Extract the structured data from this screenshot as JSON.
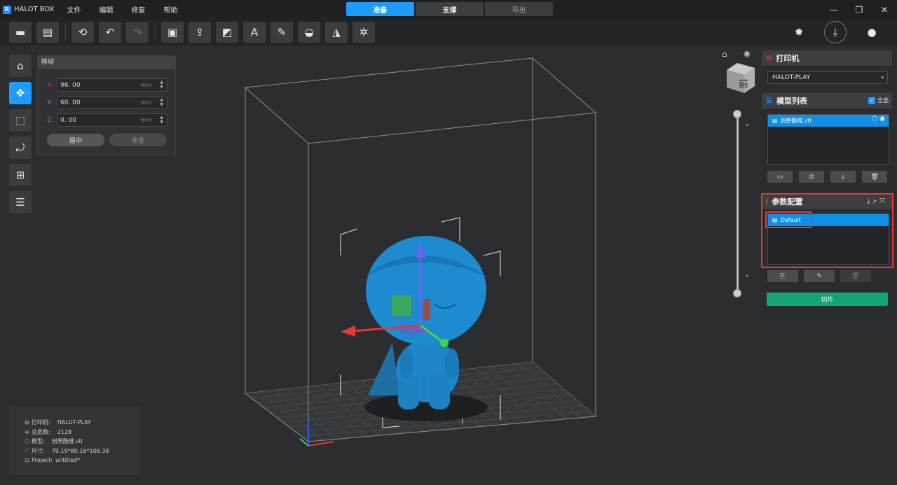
{
  "app": {
    "title": "HALOT BOX",
    "logo": "R"
  },
  "menu": [
    "文件",
    "编辑",
    "修复",
    "帮助"
  ],
  "mode_tabs": [
    {
      "label": "准备",
      "state": "active"
    },
    {
      "label": "支撑",
      "state": "normal"
    },
    {
      "label": "导出",
      "state": "disabled"
    }
  ],
  "window_controls": {
    "minimize": "—",
    "restore": "❐",
    "close": "✕"
  },
  "toolbar": {
    "open": "▬",
    "import": "▤",
    "history": "⟲",
    "undo": "↶",
    "redo": "↷",
    "tools": [
      "▣",
      "⇪",
      "◩",
      "A",
      "✎",
      "◒",
      "◮",
      "✲"
    ],
    "right": {
      "settings": "✹",
      "download": "⤓",
      "user": "●"
    }
  },
  "left_tools": [
    "⌂",
    "✥",
    "⬚",
    "⤾",
    "⊞",
    "☰"
  ],
  "move_panel": {
    "title": "移动",
    "x_label": "X:",
    "x_value": "96. 00",
    "y_label": "Y:",
    "y_value": "60. 00",
    "z_label": "Z:",
    "z_value": "0. 00",
    "unit": "mm",
    "center_btn": "居中",
    "reset_btn": "重置",
    "colors": {
      "x": "#e53935",
      "y": "#43c443",
      "z": "#3b82f6"
    }
  },
  "info": {
    "printer_label": "打印机:",
    "printer_value": "HALOT-PLAY",
    "layers_label": "总层数:",
    "layers_value": "2128",
    "model_label": "模型:",
    "model_value": "创想酷维.stl",
    "size_label": "尺寸:",
    "size_value": "79.19*80.16*106.38",
    "project_label": "Project:",
    "project_value": "untitled*"
  },
  "viewcube": {
    "face": "前"
  },
  "viewport_icons": {
    "home": "⌂",
    "eye": "◉"
  },
  "slider_chevrons": {
    "down": "⌄",
    "up": "⌃"
  },
  "printer_section": {
    "title": "打印机",
    "selected": "HALOT-PLAY"
  },
  "model_section": {
    "title": "模型列表",
    "select_all": "全选",
    "items": [
      {
        "name": "创想酷维.stl"
      }
    ],
    "buttons": [
      "▭",
      "⎙",
      "⤓",
      "🗑"
    ]
  },
  "param_section": {
    "title": "参数配置",
    "items": [
      {
        "name": "Default"
      }
    ],
    "buttons": [
      "⎘",
      "✎",
      "🗑"
    ],
    "head_icons": "⤓⤴⤧"
  },
  "slice_btn": "切片",
  "colors": {
    "accent": "#1e9bff",
    "slice": "#12a379",
    "highlight": "#e53935",
    "model": "#1c86c8"
  }
}
